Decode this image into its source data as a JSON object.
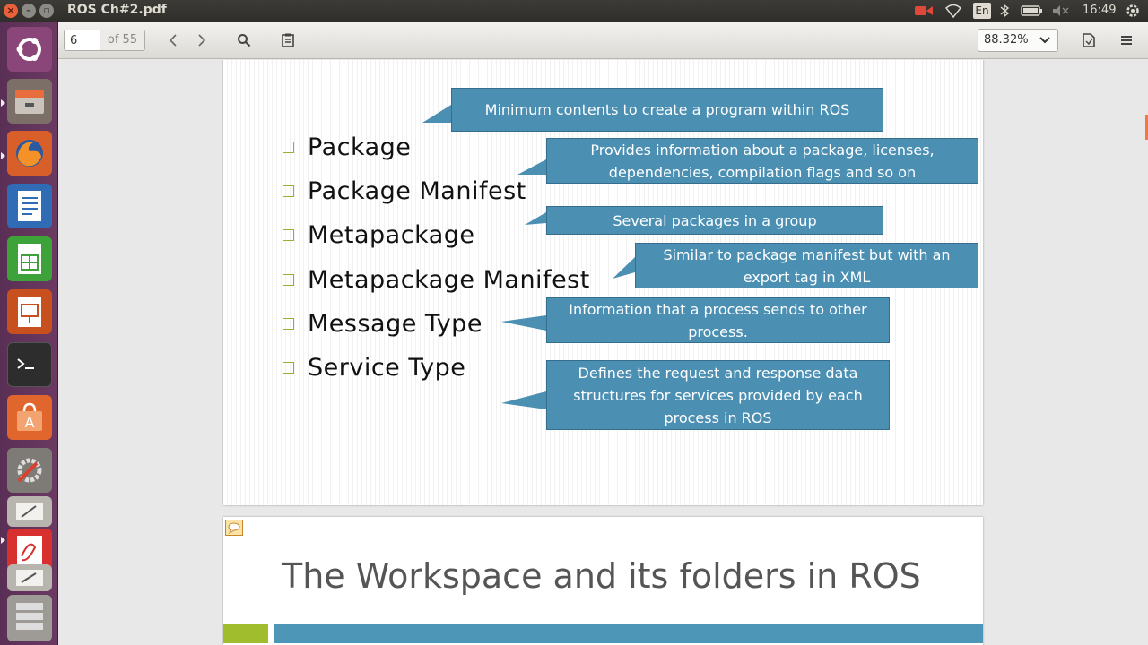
{
  "window": {
    "title": "ROS Ch#2.pdf",
    "close_glyph": "×",
    "min_glyph": "–",
    "max_glyph": "▫"
  },
  "tray": {
    "keyboard": "En",
    "time": "16:49",
    "icons": [
      "record-icon",
      "wifi-icon",
      "keyboard-layout-icon",
      "bluetooth-icon",
      "battery-icon",
      "volume-muted-icon",
      "power-gear-icon"
    ]
  },
  "launcher": {
    "items": [
      "ubuntu-dash",
      "files",
      "firefox",
      "libreoffice-writer",
      "libreoffice-calc",
      "libreoffice-impress",
      "terminal",
      "software-center",
      "system-settings",
      "text-editor",
      "document-viewer",
      "text-editor-2",
      "workspace-switcher"
    ]
  },
  "toolbar": {
    "page_number": "6",
    "page_of": "of 55",
    "zoom": "88.32%"
  },
  "slide": {
    "items": [
      {
        "label": "Package",
        "callout": "Minimum contents to create a program within ROS"
      },
      {
        "label": "Package Manifest",
        "callout": "Provides information about a package, licenses, dependencies, compilation flags and so on"
      },
      {
        "label": "Metapackage",
        "callout": "Several packages in a group"
      },
      {
        "label": "Metapackage Manifest",
        "callout": "Similar to package manifest but with an export tag in XML"
      },
      {
        "label": "Message Type",
        "callout": "Information that a process sends to other process."
      },
      {
        "label": "Service Type",
        "callout": "Defines the request and response data structures for services provided by each process in ROS"
      }
    ]
  },
  "next_slide": {
    "title": "The Workspace and its folders in ROS"
  },
  "colors": {
    "accent_green": "#9fbd2c",
    "accent_blue": "#4d96b7",
    "callout_fill": "#4b8fb3",
    "launcher": "#5e2750"
  }
}
